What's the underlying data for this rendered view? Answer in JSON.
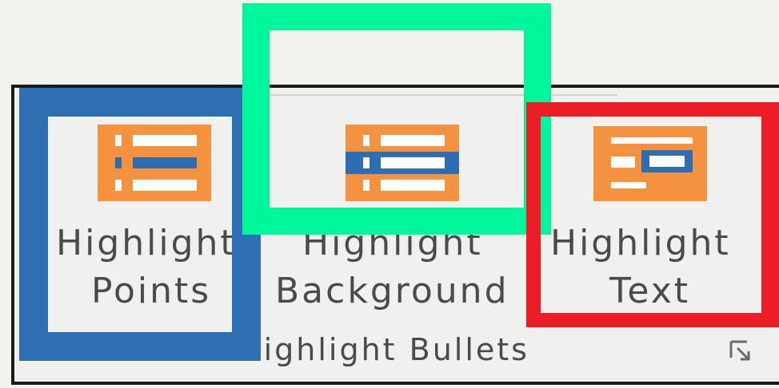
{
  "ribbon": {
    "group_label": "Highlight Bullets",
    "buttons": [
      {
        "id": "highlight-points",
        "line1": "Highlight",
        "line2": "Points",
        "icon": "highlight-points-icon"
      },
      {
        "id": "highlight-background",
        "line1": "Highlight",
        "line2": "Background",
        "icon": "highlight-background-icon"
      },
      {
        "id": "highlight-text",
        "line1": "Highlight",
        "line2": "Text",
        "icon": "highlight-text-icon"
      }
    ],
    "dialog_launcher_icon": "dialog-launcher-icon"
  },
  "colors": {
    "icon_orange": "#f4923f",
    "icon_blue": "#2e6db4",
    "annotation_blue": "#2d6fb2",
    "annotation_green": "#00f69a",
    "annotation_red": "#ee1c25"
  }
}
